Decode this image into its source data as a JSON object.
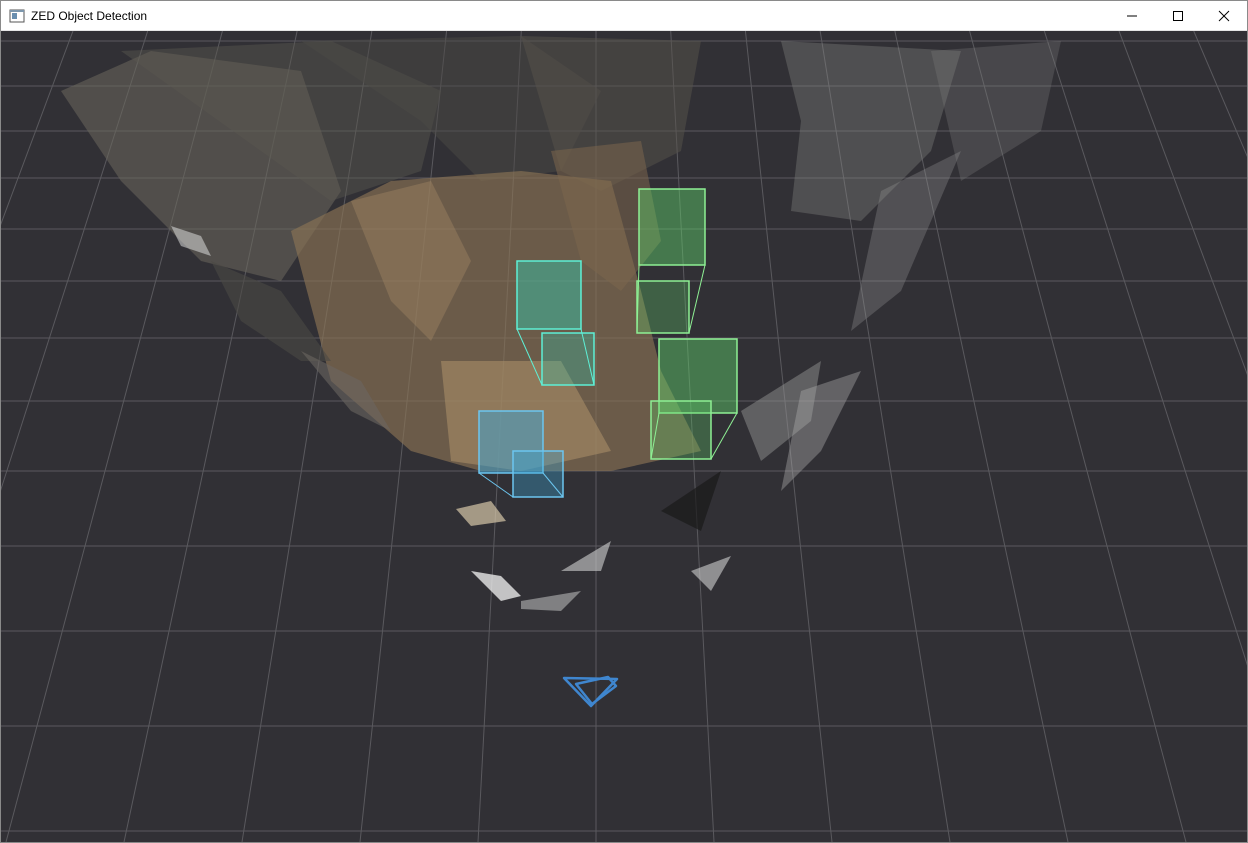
{
  "window": {
    "title": "ZED Object Detection",
    "app_icon": "window-app-icon",
    "controls": [
      {
        "name": "minimize-button",
        "icon": "minimize-icon"
      },
      {
        "name": "maximize-button",
        "icon": "maximize-icon"
      },
      {
        "name": "close-button",
        "icon": "close-icon"
      }
    ]
  },
  "viewer": {
    "background_color": "#313035",
    "grid_color": "#5a595e",
    "camera_color": "#3f86cf",
    "objects": [
      {
        "id": "obj-1",
        "color": "#33c9b0"
      },
      {
        "id": "obj-2",
        "color": "#5fd06a"
      },
      {
        "id": "obj-3",
        "color": "#5fd06a"
      },
      {
        "id": "obj-4",
        "color": "#3ba6d8"
      }
    ]
  }
}
